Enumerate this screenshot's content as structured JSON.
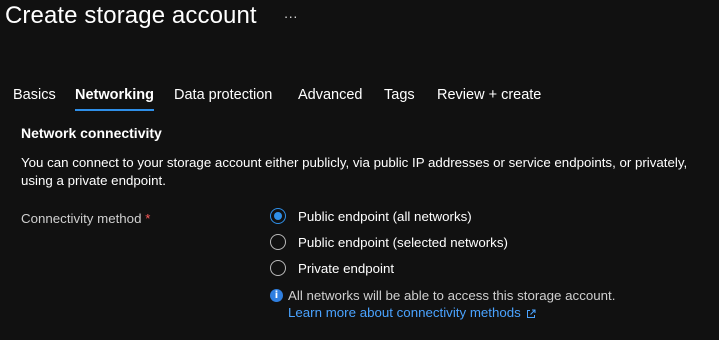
{
  "header": {
    "title": "Create storage account",
    "more_label": "···"
  },
  "tabs": [
    {
      "label": "Basics",
      "active": false
    },
    {
      "label": "Networking",
      "active": true
    },
    {
      "label": "Data protection",
      "active": false
    },
    {
      "label": "Advanced",
      "active": false
    },
    {
      "label": "Tags",
      "active": false
    },
    {
      "label": "Review + create",
      "active": false
    }
  ],
  "section": {
    "title": "Network connectivity",
    "description": "You can connect to your storage account either publicly, via public IP addresses or service endpoints, or privately, using a private endpoint."
  },
  "connectivity": {
    "label": "Connectivity method",
    "required_marker": "*",
    "options": [
      {
        "label": "Public endpoint (all networks)",
        "selected": true
      },
      {
        "label": "Public endpoint (selected networks)",
        "selected": false
      },
      {
        "label": "Private endpoint",
        "selected": false
      }
    ],
    "info_icon_glyph": "i",
    "info_text": "All networks will be able to access this storage account.",
    "learn_more_link": "Learn more about connectivity methods"
  },
  "icons": {
    "more": "more-ellipsis-icon",
    "info": "info-icon",
    "external_link": "external-link-icon"
  },
  "colors": {
    "background": "#111111",
    "accent": "#2f8fe8",
    "link": "#4aa3ff",
    "required": "#ff5a5a"
  }
}
